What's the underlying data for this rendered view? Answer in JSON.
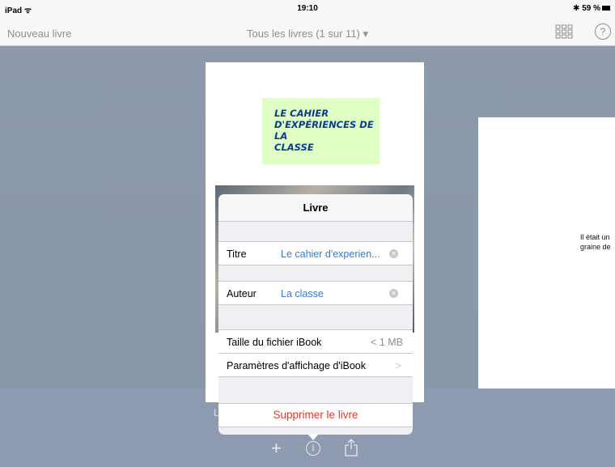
{
  "status": {
    "device": "iPad ᯤ",
    "time": "19:10",
    "battery": "✱ 59 %"
  },
  "nav": {
    "new_book": "Nouveau livre",
    "title": "Tous les livres (1 sur 11) ▾",
    "help": "?"
  },
  "cover": {
    "line1": "LE CAHIER",
    "line2": "D'EXPÉRIENCES DE LA",
    "line3": "CLASSE"
  },
  "next_book": {
    "line1": "Il était un",
    "line2": "graine de"
  },
  "shelf": {
    "letter": "L"
  },
  "popover": {
    "title": "Livre",
    "title_label": "Titre",
    "title_value": "Le cahier d'experien...",
    "author_label": "Auteur",
    "author_value": "La classe",
    "size_label": "Taille du fichier iBook",
    "size_value": "< 1 MB",
    "display_label": "Paramètres d'affichage d'iBook",
    "display_chevron": ">",
    "delete_label": "Supprimer le livre"
  },
  "toolbar": {
    "plus": "+",
    "info": "i"
  },
  "icons": [
    "grid-view-icon",
    "help-icon",
    "clear-icon",
    "chevron-right-icon",
    "plus-icon",
    "info-icon",
    "share-icon"
  ],
  "colors": {
    "accent": "#2d7ed6",
    "destructive": "#e0392e",
    "shelf": "#8a97a8"
  }
}
